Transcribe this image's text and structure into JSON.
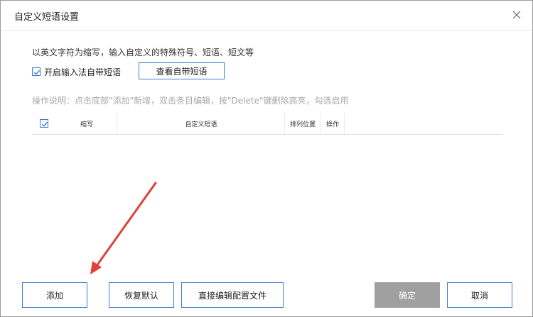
{
  "dialog": {
    "title": "自定义短语设置",
    "close_icon": "close-icon"
  },
  "intro_text": "以英文字符为缩写，输入自定义的特殊符号、短语、短文等",
  "builtin_toggle": {
    "label": "开启输入法自带短语",
    "checked": true
  },
  "view_builtin_button": "查看自带短语",
  "hint_text": "操作说明：点击底部\"添加\"新增，双击条目编辑，按\"Delete\"键删除高亮，勾选启用",
  "table": {
    "columns": [
      "缩写",
      "自定义短语",
      "排列位置",
      "操作"
    ],
    "rows": []
  },
  "footer": {
    "add_label": "添加",
    "restore_label": "恢复默认",
    "edit_config_label": "直接编辑配置文件",
    "ok_label": "确定",
    "cancel_label": "取消"
  },
  "colors": {
    "accent": "#3a7bd5",
    "disabled": "#a0a0a0",
    "annotation": "#e0403a"
  }
}
